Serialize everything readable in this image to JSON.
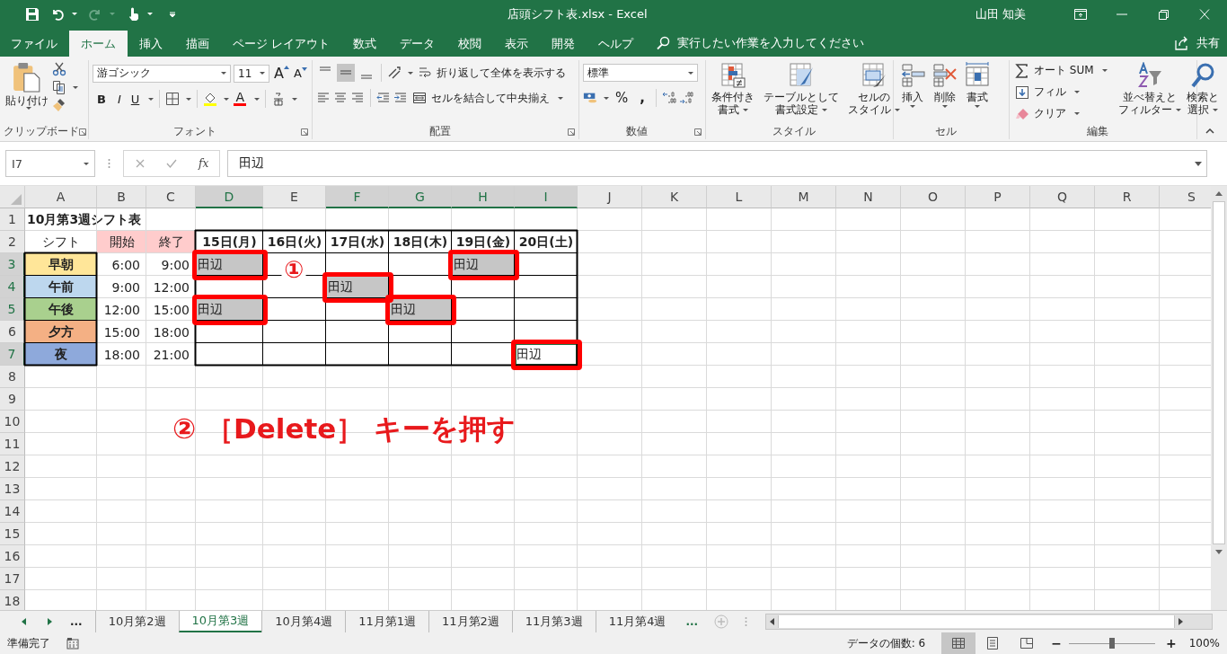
{
  "title_bar": {
    "title": "店頭シフト表.xlsx - Excel",
    "user": "山田 知美"
  },
  "menu_tabs": [
    {
      "label": "ファイル",
      "selected": false
    },
    {
      "label": "ホーム",
      "selected": true
    },
    {
      "label": "挿入",
      "selected": false
    },
    {
      "label": "描画",
      "selected": false
    },
    {
      "label": "ページ レイアウト",
      "selected": false
    },
    {
      "label": "数式",
      "selected": false
    },
    {
      "label": "データ",
      "selected": false
    },
    {
      "label": "校閲",
      "selected": false
    },
    {
      "label": "表示",
      "selected": false
    },
    {
      "label": "開発",
      "selected": false
    },
    {
      "label": "ヘルプ",
      "selected": false
    }
  ],
  "tell_me": {
    "placeholder": "実行したい作業を入力してください"
  },
  "share": {
    "label": "共有"
  },
  "ribbon": [
    {
      "kind": "clipboard",
      "label": "クリップボード",
      "paste": "貼り付け"
    },
    {
      "kind": "font",
      "label": "フォント",
      "font_name": "游ゴシック",
      "font_size": "11",
      "grow": "A",
      "shrink": "A",
      "bold": "B",
      "italic": "I",
      "underline": "U",
      "font_color": "A"
    },
    {
      "kind": "alignment",
      "label": "配置",
      "vertical_align": [
        {
          "selected": false
        },
        {
          "selected": true
        },
        {
          "selected": false
        }
      ],
      "wrap_text": "折り返して全体を表示する",
      "merge": "セルを結合して中央揃え"
    },
    {
      "kind": "number",
      "label": "数値",
      "format": "標準",
      "percent": "%",
      "comma": ","
    },
    {
      "kind": "styles",
      "label": "スタイル",
      "buttons": [
        [
          "条件付き",
          "書式"
        ],
        [
          "テーブルとして",
          "書式設定"
        ],
        [
          "セルの",
          "スタイル"
        ]
      ]
    },
    {
      "kind": "cells",
      "label": "セル",
      "buttons": [
        "挿入",
        "削除",
        "書式"
      ]
    },
    {
      "kind": "editing",
      "label": "編集",
      "autosum": "オート SUM",
      "fill": "フィル",
      "clear": "クリア",
      "sort": [
        "並べ替えと",
        "フィルター"
      ],
      "find": [
        "検索と",
        "選択"
      ]
    }
  ],
  "formula_bar": {
    "name_box": "I7",
    "function_label": "fx",
    "value": "田辺"
  },
  "sheet": {
    "columns": [
      {
        "label": "A",
        "selected": false
      },
      {
        "label": "B",
        "selected": false
      },
      {
        "label": "C",
        "selected": false
      },
      {
        "label": "D",
        "selected": true
      },
      {
        "label": "E",
        "selected": false
      },
      {
        "label": "F",
        "selected": true
      },
      {
        "label": "G",
        "selected": true
      },
      {
        "label": "H",
        "selected": true
      },
      {
        "label": "I",
        "selected": true
      },
      {
        "label": "J",
        "selected": false
      },
      {
        "label": "K",
        "selected": false
      },
      {
        "label": "L",
        "selected": false
      },
      {
        "label": "M",
        "selected": false
      },
      {
        "label": "N",
        "selected": false
      },
      {
        "label": "O",
        "selected": false
      },
      {
        "label": "P",
        "selected": false
      },
      {
        "label": "Q",
        "selected": false
      },
      {
        "label": "R",
        "selected": false
      },
      {
        "label": "S",
        "selected": false
      }
    ],
    "rows": [
      {
        "label": "1",
        "selected": false,
        "cells": [
          {
            "text": "10月第3週シフト表",
            "kind": "title",
            "selected": false,
            "marked": false,
            "active": false
          }
        ]
      },
      {
        "label": "2",
        "selected": false,
        "cells": [
          {
            "text": "シフト",
            "kind": "center",
            "selected": false,
            "marked": false,
            "active": false
          },
          {
            "text": "開始",
            "kind": "center",
            "color": "#ffcccc",
            "selected": false,
            "marked": false,
            "active": false
          },
          {
            "text": "終了",
            "kind": "center",
            "color": "#ffcccc",
            "selected": false,
            "marked": false,
            "active": false
          },
          {
            "text": "15日(月)",
            "kind": "day",
            "selected": false,
            "marked": false,
            "active": false
          },
          {
            "text": "16日(火)",
            "kind": "day",
            "selected": false,
            "marked": false,
            "active": false
          },
          {
            "text": "17日(水)",
            "kind": "day",
            "selected": false,
            "marked": false,
            "active": false
          },
          {
            "text": "18日(木)",
            "kind": "day",
            "selected": false,
            "marked": false,
            "active": false
          },
          {
            "text": "19日(金)",
            "kind": "day",
            "selected": false,
            "marked": false,
            "active": false
          },
          {
            "text": "20日(土)",
            "kind": "day",
            "selected": false,
            "marked": false,
            "active": false
          }
        ]
      },
      {
        "label": "3",
        "selected": true,
        "cells": [
          {
            "text": "早朝",
            "kind": "label",
            "color": "#ffe699",
            "selected": false,
            "marked": false,
            "active": false
          },
          {
            "text": "6:00",
            "kind": "time",
            "selected": false,
            "marked": false,
            "active": false
          },
          {
            "text": "9:00",
            "kind": "time",
            "selected": false,
            "marked": false,
            "active": false
          },
          {
            "text": "田辺",
            "kind": "name",
            "selected": true,
            "marked": true,
            "active": false
          },
          {
            "kind": "empty"
          },
          {
            "kind": "empty"
          },
          {
            "kind": "empty"
          },
          {
            "text": "田辺",
            "kind": "name",
            "selected": true,
            "marked": true,
            "active": false
          },
          {
            "kind": "empty"
          }
        ]
      },
      {
        "label": "4",
        "selected": true,
        "cells": [
          {
            "text": "午前",
            "kind": "label",
            "color": "#bdd7ee",
            "selected": false,
            "marked": false,
            "active": false
          },
          {
            "text": "9:00",
            "kind": "time",
            "selected": false,
            "marked": false,
            "active": false
          },
          {
            "text": "12:00",
            "kind": "time",
            "selected": false,
            "marked": false,
            "active": false
          },
          {
            "kind": "empty"
          },
          {
            "kind": "empty"
          },
          {
            "text": "田辺",
            "kind": "name",
            "selected": true,
            "marked": true,
            "active": false
          },
          {
            "kind": "empty"
          },
          {
            "kind": "empty"
          },
          {
            "kind": "empty"
          }
        ]
      },
      {
        "label": "5",
        "selected": true,
        "cells": [
          {
            "text": "午後",
            "kind": "label",
            "color": "#a9d08e",
            "selected": false,
            "marked": false,
            "active": false
          },
          {
            "text": "12:00",
            "kind": "time",
            "selected": false,
            "marked": false,
            "active": false
          },
          {
            "text": "15:00",
            "kind": "time",
            "selected": false,
            "marked": false,
            "active": false
          },
          {
            "text": "田辺",
            "kind": "name",
            "selected": true,
            "marked": true,
            "active": false
          },
          {
            "kind": "empty"
          },
          {
            "kind": "empty"
          },
          {
            "text": "田辺",
            "kind": "name",
            "selected": true,
            "marked": true,
            "active": false
          },
          {
            "kind": "empty"
          },
          {
            "kind": "empty"
          }
        ]
      },
      {
        "label": "6",
        "selected": false,
        "cells": [
          {
            "text": "夕方",
            "kind": "label",
            "color": "#f4b084",
            "selected": false,
            "marked": false,
            "active": false
          },
          {
            "text": "15:00",
            "kind": "time",
            "selected": false,
            "marked": false,
            "active": false
          },
          {
            "text": "18:00",
            "kind": "time",
            "selected": false,
            "marked": false,
            "active": false
          }
        ]
      },
      {
        "label": "7",
        "selected": true,
        "cells": [
          {
            "text": "夜",
            "kind": "label",
            "color": "#8ea9db",
            "selected": false,
            "marked": false,
            "active": false
          },
          {
            "text": "18:00",
            "kind": "time",
            "selected": false,
            "marked": false,
            "active": false
          },
          {
            "text": "21:00",
            "kind": "time",
            "selected": false,
            "marked": false,
            "active": false
          },
          {
            "kind": "empty"
          },
          {
            "kind": "empty"
          },
          {
            "kind": "empty"
          },
          {
            "kind": "empty"
          },
          {
            "kind": "empty"
          },
          {
            "text": "田辺",
            "kind": "name",
            "marked": true,
            "active": true
          }
        ]
      },
      {
        "label": "8",
        "selected": false
      },
      {
        "label": "9",
        "selected": false
      },
      {
        "label": "10",
        "selected": false
      },
      {
        "label": "11",
        "selected": false
      },
      {
        "label": "12",
        "selected": false
      },
      {
        "label": "13",
        "selected": false
      },
      {
        "label": "14",
        "selected": false
      },
      {
        "label": "15",
        "selected": false
      },
      {
        "label": "16",
        "selected": false
      },
      {
        "label": "17",
        "selected": false
      },
      {
        "label": "18",
        "selected": false
      }
    ]
  },
  "annotations": {
    "step1": "①",
    "step2": "② ［Delete］ キーを押す"
  },
  "sheet_tabs": {
    "overflow_left": "...",
    "tabs": [
      {
        "label": "10月第2週",
        "selected": false
      },
      {
        "label": "10月第3週",
        "selected": true
      },
      {
        "label": "10月第4週",
        "selected": false
      },
      {
        "label": "11月第1週",
        "selected": false
      },
      {
        "label": "11月第2週",
        "selected": false
      },
      {
        "label": "11月第3週",
        "selected": false
      },
      {
        "label": "11月第4週",
        "selected": false
      }
    ],
    "overflow_right": "..."
  },
  "status_bar": {
    "status": "準備完了",
    "summary": "データの個数: 6",
    "views": [
      {
        "kind": "normal",
        "selected": true
      },
      {
        "kind": "page-layout",
        "selected": false
      },
      {
        "kind": "page-break",
        "selected": false
      }
    ],
    "zoom": {
      "minus": "−",
      "plus": "+",
      "level": 0.5,
      "reading": "100%"
    }
  }
}
